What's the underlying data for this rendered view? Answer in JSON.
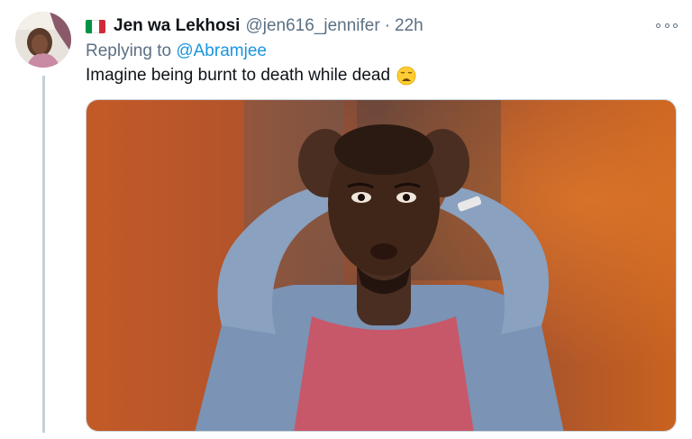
{
  "tweet": {
    "author_name": "Jen wa Lekhosi",
    "author_handle": "@jen616_jennifer",
    "separator": "·",
    "timestamp": "22h",
    "flag_icon": "italy-flag-icon",
    "flag_colors": [
      "#009246",
      "#ffffff",
      "#ce2b37"
    ],
    "replying_prefix": "Replying to",
    "replying_to": "@Abramjee",
    "text": "Imagine being burnt to death while dead",
    "emoji_icon": "weary-face-emoji-icon",
    "more_icon": "more-options-icon"
  },
  "colors": {
    "secondary_text": "#5b7083",
    "link": "#1b95e0",
    "thread_line": "#c4cfd6"
  }
}
